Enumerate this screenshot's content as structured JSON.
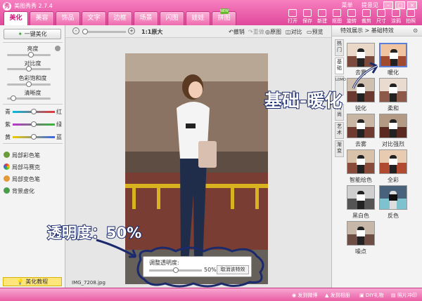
{
  "app": {
    "title": "美图秀秀 2.7.4",
    "logo": "秀"
  },
  "menu": {
    "links": [
      "菜单",
      "提意见"
    ]
  },
  "tabs": [
    "美化",
    "美容",
    "饰品",
    "文字",
    "边框",
    "场景",
    "闪图",
    "娃娃",
    "拼图"
  ],
  "new_badge": "NEW",
  "toolbar": [
    "打开",
    "保存",
    "新建",
    "抠图",
    "旋转",
    "裁剪",
    "尺寸",
    "涂鸦",
    "拍照"
  ],
  "left_panel": {
    "one_key": "一键美化",
    "sliders": [
      {
        "label": "亮度",
        "value": 0.55
      },
      {
        "label": "对比度",
        "value": 0.5
      },
      {
        "label": "色彩饱和度",
        "value": 0.5
      },
      {
        "label": "清晰度",
        "value": 0.1
      }
    ],
    "color_sliders": [
      {
        "left": "青",
        "right": "红",
        "value": 0.5
      },
      {
        "left": "紫",
        "right": "绿",
        "value": 0.5
      },
      {
        "left": "黄",
        "right": "蓝",
        "value": 0.5
      }
    ],
    "tools": [
      "局部彩色笔",
      "局部马赛克",
      "局部变色笔",
      "背景虚化"
    ],
    "tutorial": "美化教程"
  },
  "canvas_toolbar": {
    "ratio": "1:1原大",
    "undo": "撤销",
    "redo": "重做",
    "original": "原图",
    "compare": "对比",
    "preview": "预览"
  },
  "filename": "IMG_7208.jpg",
  "right_panel": {
    "header": "特效展示 > 基础特效",
    "vtabs": [
      "热门",
      "基础",
      "LOMO",
      "时尚",
      "艺术",
      "渐变"
    ],
    "effects": [
      "去雾",
      "暖化",
      "锐化",
      "柔和",
      "去雾",
      "对比强烈",
      "智能绘色",
      "全彩",
      "黑白色",
      "反色",
      "噪点"
    ]
  },
  "opacity_dialog": {
    "label": "调整透明度:",
    "value": "50%",
    "cancel": "取消该特效",
    "level": 0.5
  },
  "statusbar": [
    "发到微博",
    "发到相册",
    "DIY礼物",
    "照片冲印"
  ],
  "annotations": {
    "effect": "基础-暖化",
    "opacity": "透明度：50%"
  }
}
